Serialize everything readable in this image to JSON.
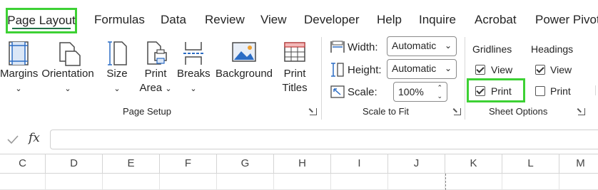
{
  "tabs": [
    "Page Layout",
    "Formulas",
    "Data",
    "Review",
    "View",
    "Developer",
    "Help",
    "Inquire",
    "Acrobat",
    "Power Pivot"
  ],
  "page_setup": {
    "group_label": "Page Setup",
    "buttons": {
      "margins": "Margins",
      "orientation": "Orientation",
      "size": "Size",
      "print_area_line1": "Print",
      "print_area_line2": "Area",
      "breaks": "Breaks",
      "background": "Background",
      "print_titles_line1": "Print",
      "print_titles_line2": "Titles"
    }
  },
  "scale_to_fit": {
    "group_label": "Scale to Fit",
    "width_label": "Width:",
    "width_value": "Automatic",
    "height_label": "Height:",
    "height_value": "Automatic",
    "scale_label": "Scale:",
    "scale_value": "100%"
  },
  "sheet_options": {
    "group_label": "Sheet Options",
    "gridlines": {
      "title": "Gridlines",
      "view_label": "View",
      "view_checked": true,
      "print_label": "Print",
      "print_checked": true
    },
    "headings": {
      "title": "Headings",
      "view_label": "View",
      "view_checked": true,
      "print_label": "Print",
      "print_checked": false
    }
  },
  "formula_bar": {
    "fx_label": "fx",
    "value": ""
  },
  "columns": [
    "C",
    "D",
    "E",
    "F",
    "G",
    "H",
    "I",
    "J",
    "K",
    "L",
    "M"
  ],
  "colors": {
    "highlight": "#3dd134",
    "accent": "#217346"
  }
}
